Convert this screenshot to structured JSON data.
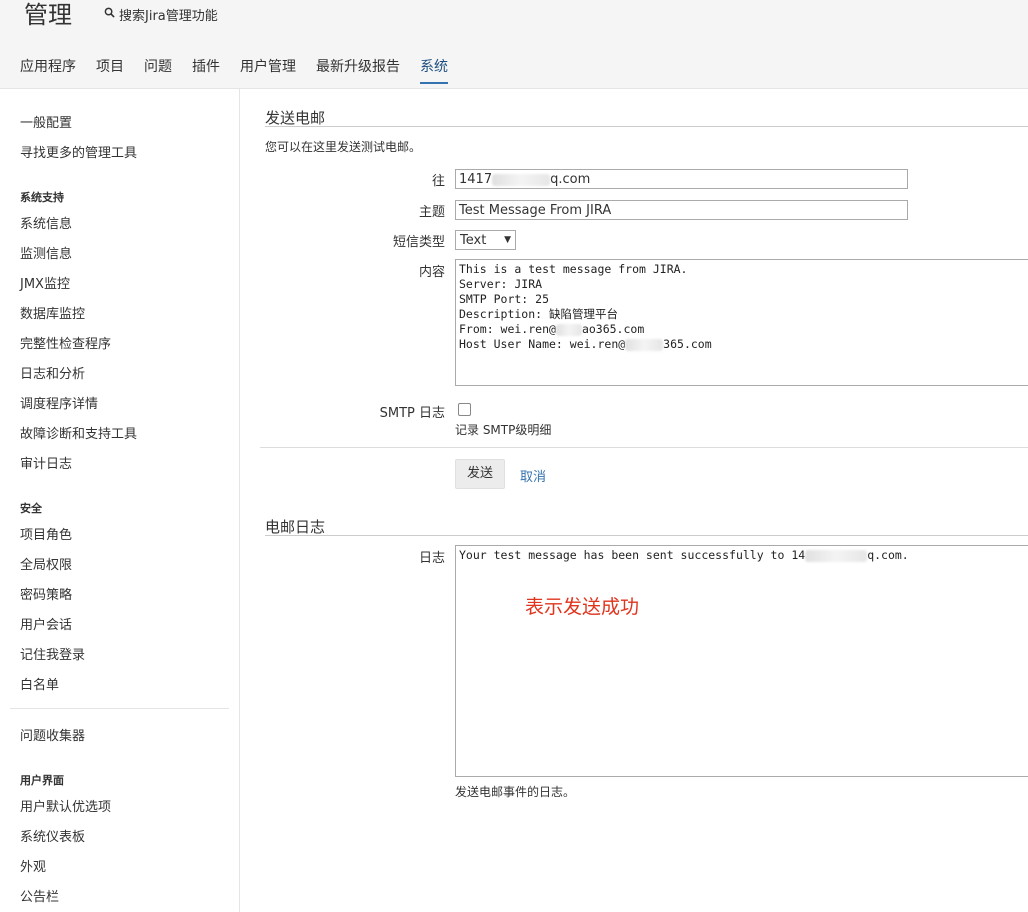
{
  "header": {
    "title": "管理",
    "search_label": "搜索Jira管理功能",
    "search_icon": "search-icon",
    "tabs": [
      {
        "label": "应用程序"
      },
      {
        "label": "项目"
      },
      {
        "label": "问题"
      },
      {
        "label": "插件"
      },
      {
        "label": "用户管理"
      },
      {
        "label": "最新升级报告"
      },
      {
        "label": "系统",
        "active": true
      }
    ]
  },
  "sidebar": {
    "top": [
      "一般配置",
      "寻找更多的管理工具"
    ],
    "system_support_title": "系统支持",
    "system_support": [
      "系统信息",
      "监测信息",
      "JMX监控",
      "数据库监控",
      "完整性检查程序",
      "日志和分析",
      "调度程序详情",
      "故障诊断和支持工具",
      "审计日志"
    ],
    "security_title": "安全",
    "security": [
      "项目角色",
      "全局权限",
      "密码策略",
      "用户会话",
      "记住我登录",
      "白名单"
    ],
    "issue_collector": "问题收集器",
    "ui_title": "用户界面",
    "ui": [
      "用户默认优选项",
      "系统仪表板",
      "外观",
      "公告栏"
    ]
  },
  "send_mail": {
    "title": "发送电邮",
    "description": "您可以在这里发送测试电邮。",
    "to_label": "往",
    "to_value_prefix": "1417",
    "to_value_suffix": "q.com",
    "subject_label": "主题",
    "subject_value": "Test Message From JIRA",
    "type_label": "短信类型",
    "type_value": "Text",
    "body_label": "内容",
    "body_lines": [
      "This is a test message from JIRA.",
      "Server: JIRA",
      "SMTP Port: 25",
      "Description: 缺陷管理平台",
      "From: wei.ren@",
      "Host User Name: wei.ren@"
    ],
    "body_from_suffix": "ao365.com",
    "body_host_suffix": "365.com",
    "smtp_log_label": "SMTP 日志",
    "smtp_log_checked": false,
    "smtp_log_hint": "记录 SMTP级明细",
    "send_button": "发送",
    "cancel_link": "取消"
  },
  "mail_log": {
    "title": "电邮日志",
    "log_label": "日志",
    "log_prefix": "Your test message has been sent successfully to 14",
    "log_suffix": "q.com.",
    "annotation": "表示发送成功",
    "hint": "发送电邮事件的日志。"
  },
  "colors": {
    "link": "#3572b0",
    "annotation": "#e0341e"
  }
}
